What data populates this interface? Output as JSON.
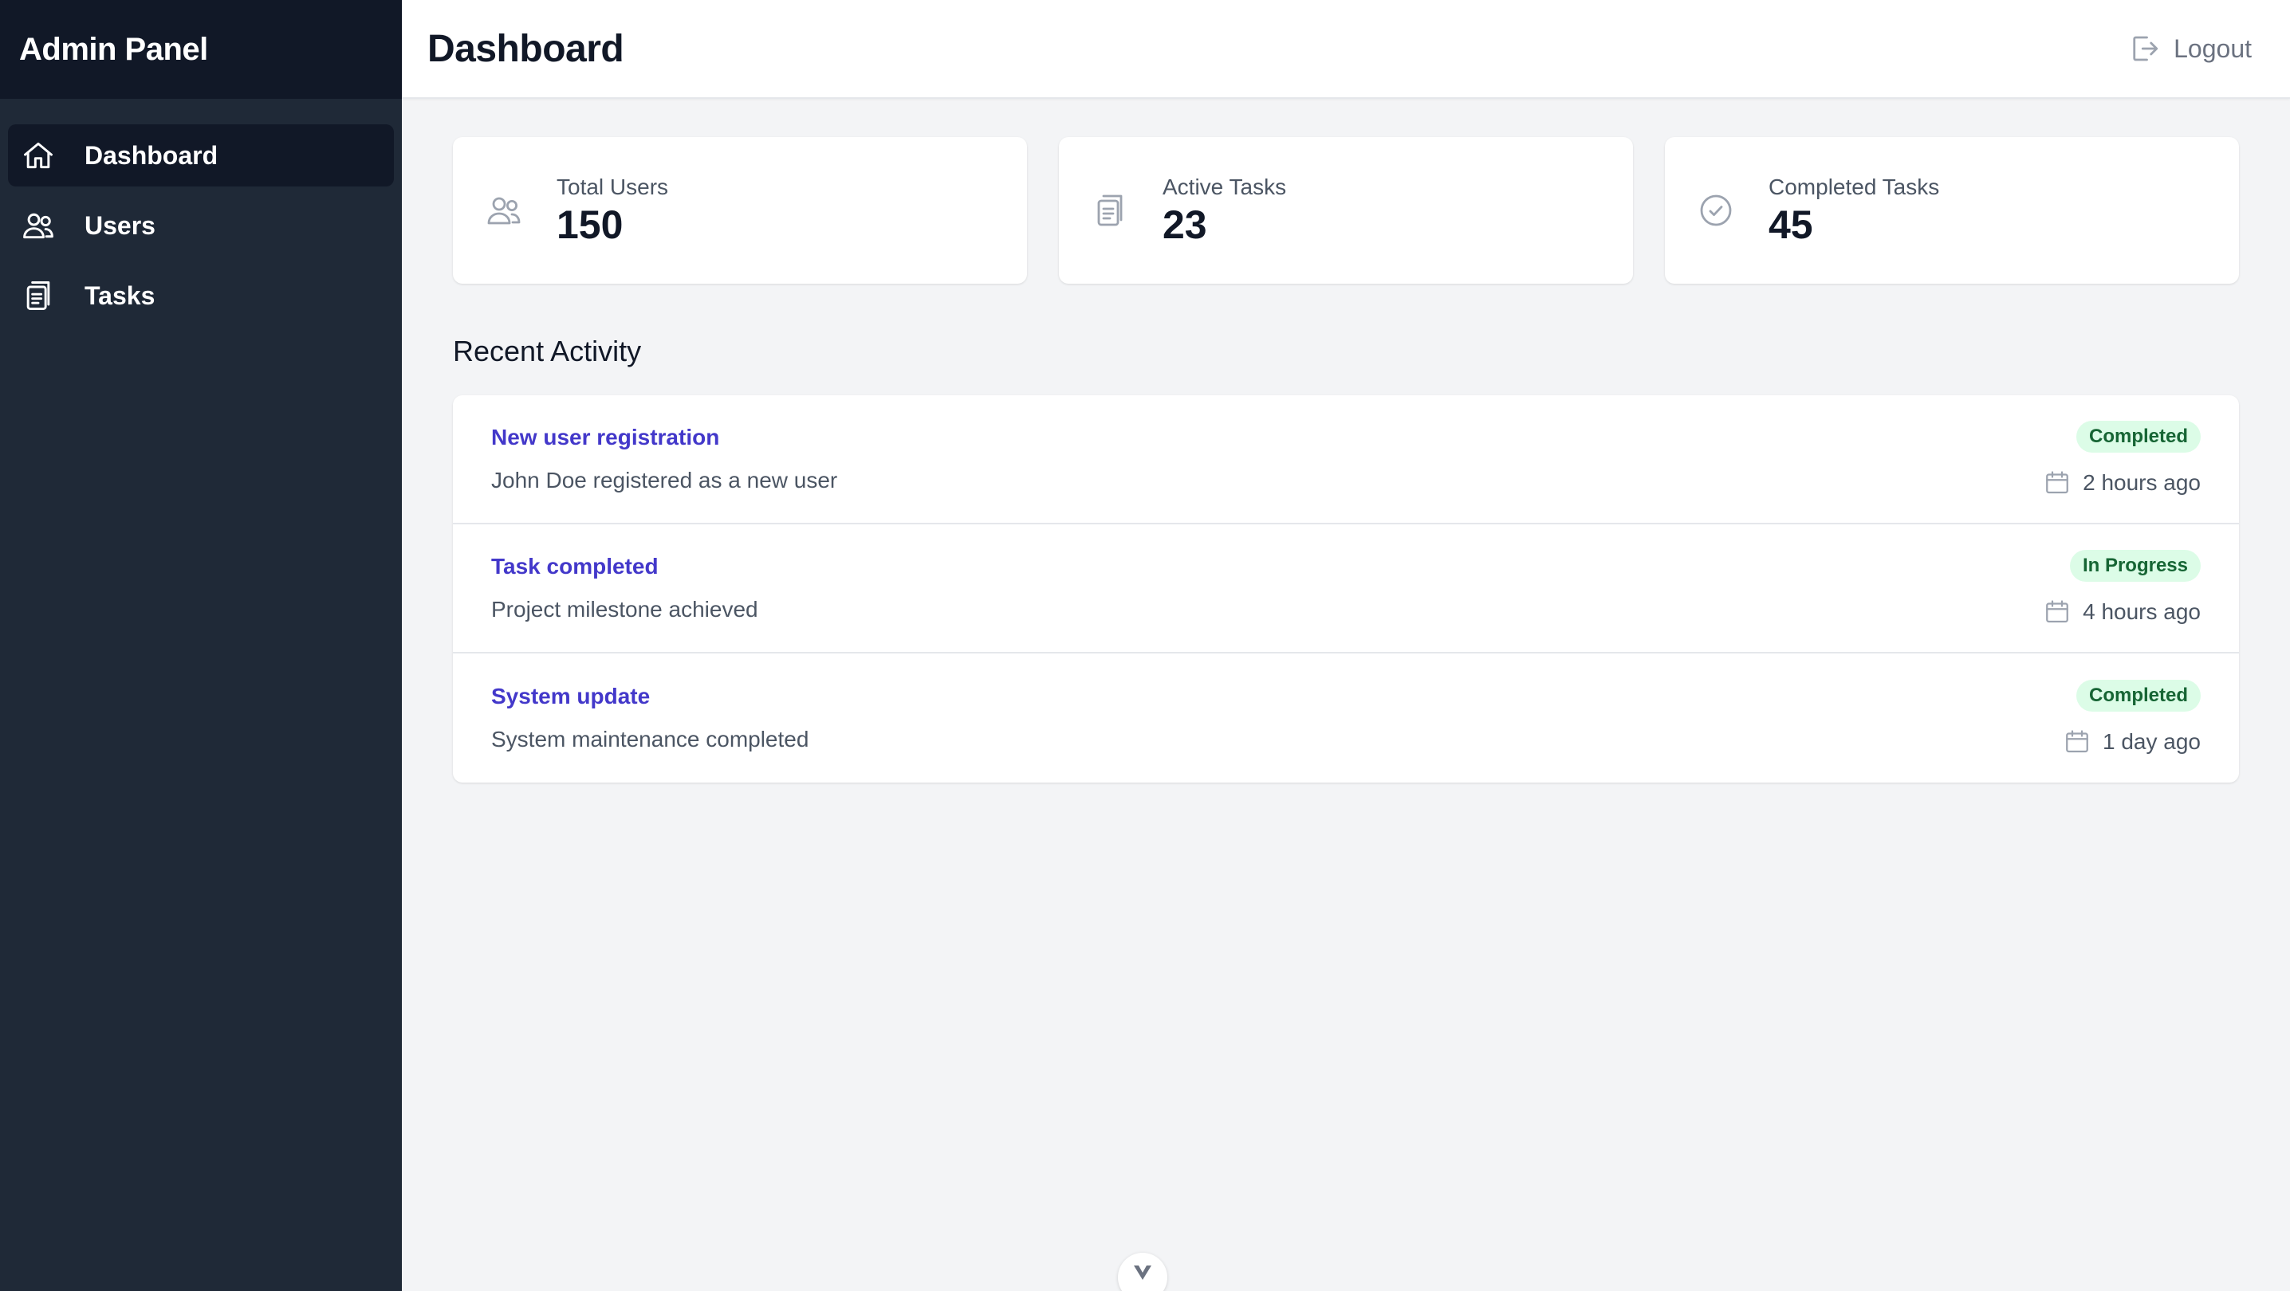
{
  "app": {
    "title": "Admin Panel"
  },
  "sidebar": {
    "items": [
      {
        "label": "Dashboard",
        "icon": "home-icon",
        "active": true
      },
      {
        "label": "Users",
        "icon": "users-icon",
        "active": false
      },
      {
        "label": "Tasks",
        "icon": "clipboard-icon",
        "active": false
      }
    ]
  },
  "header": {
    "title": "Dashboard",
    "logout_label": "Logout",
    "logout_icon": "logout-icon"
  },
  "stats": [
    {
      "label": "Total Users",
      "value": "150",
      "icon": "users-icon"
    },
    {
      "label": "Active Tasks",
      "value": "23",
      "icon": "clipboard-icon"
    },
    {
      "label": "Completed Tasks",
      "value": "45",
      "icon": "check-circle-icon"
    }
  ],
  "recent_activity": {
    "title": "Recent Activity",
    "items": [
      {
        "title": "New user registration",
        "description": "John Doe registered as a new user",
        "status": "Completed",
        "time": "2 hours ago",
        "icon": "calendar-icon"
      },
      {
        "title": "Task completed",
        "description": "Project milestone achieved",
        "status": "In Progress",
        "time": "4 hours ago",
        "icon": "calendar-icon"
      },
      {
        "title": "System update",
        "description": "System maintenance completed",
        "status": "Completed",
        "time": "1 day ago",
        "icon": "calendar-icon"
      }
    ]
  },
  "colors": {
    "sidebar_bg": "#1f2937",
    "sidebar_header_bg": "#111827",
    "accent_link": "#4338ca",
    "badge_bg": "#dcfce7",
    "badge_text": "#166534",
    "page_bg": "#f3f4f6"
  },
  "fab": {
    "icon": "chevron-down-icon"
  }
}
